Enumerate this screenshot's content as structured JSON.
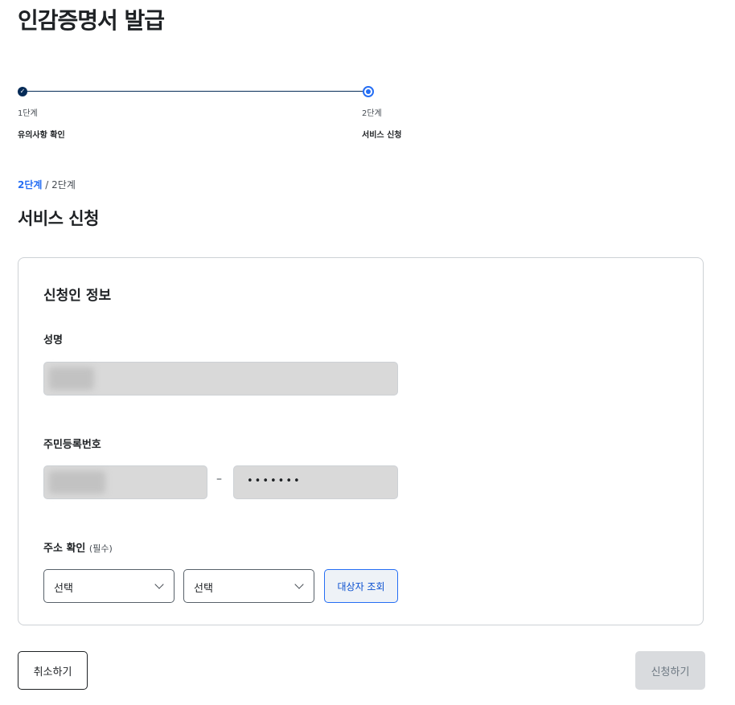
{
  "page": {
    "title": "인감증명서 발급"
  },
  "stepper": {
    "steps": [
      {
        "num": "1단계",
        "name": "유의사항 확인",
        "status": "done"
      },
      {
        "num": "2단계",
        "name": "서비스 신청",
        "status": "current"
      }
    ]
  },
  "step_indicator": {
    "current": "2단계",
    "separator": "/",
    "total": "2단계"
  },
  "section": {
    "title": "서비스 신청"
  },
  "form": {
    "title": "신청인 정보",
    "name_label": "성명",
    "rrn_label": "주민등록번호",
    "rrn_separator": "–",
    "rrn_back_masked": "•••••••",
    "address_label": "주소 확인",
    "address_required": "(필수)",
    "select1_value": "선택",
    "select2_value": "선택",
    "search_button": "대상자 조회"
  },
  "actions": {
    "cancel": "취소하기",
    "submit": "신청하기"
  },
  "colors": {
    "primary": "#256ef4",
    "navy": "#052b57",
    "disabled": "#d9dbde"
  }
}
